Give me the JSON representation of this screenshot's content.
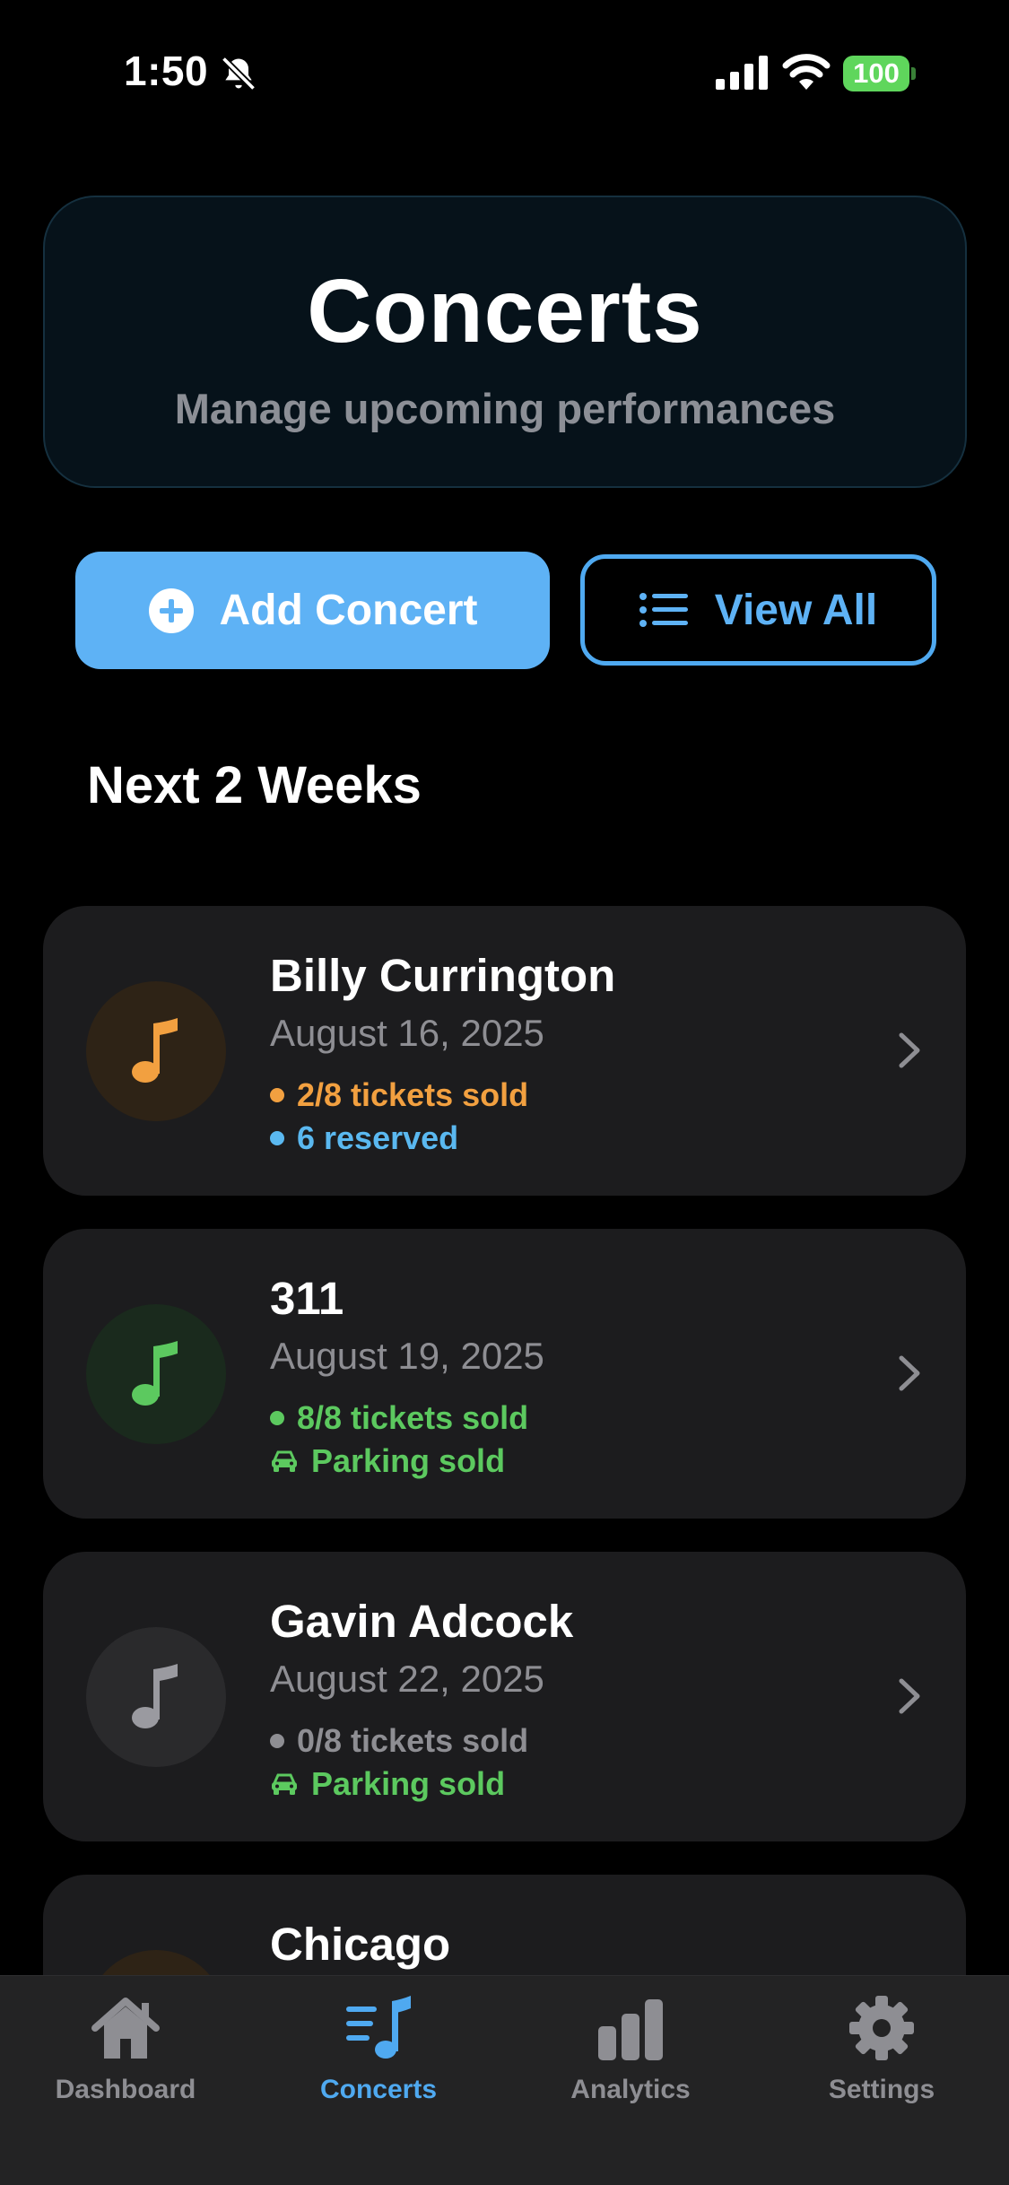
{
  "status_bar": {
    "time": "1:50",
    "battery": "100"
  },
  "header": {
    "title": "Concerts",
    "subtitle": "Manage upcoming performances"
  },
  "actions": {
    "add_label": "Add Concert",
    "view_all_label": "View All"
  },
  "section_title": "Next 2 Weeks",
  "concerts": [
    {
      "name": "Billy Currington",
      "date": "August 16, 2025",
      "tickets": "2/8 tickets sold",
      "extra": "6 reserved",
      "ticket_color": "#f2a040",
      "extra_color": "#5ab8f0",
      "extra_icon": "dot",
      "avatar_color": "#f2a040"
    },
    {
      "name": "311",
      "date": "August 19, 2025",
      "tickets": "8/8 tickets sold",
      "extra": "Parking sold",
      "ticket_color": "#5cc95f",
      "extra_color": "#5cc95f",
      "extra_icon": "car-icon",
      "avatar_color": "#5cc95f"
    },
    {
      "name": "Gavin Adcock",
      "date": "August 22, 2025",
      "tickets": "0/8 tickets sold",
      "extra": "Parking sold",
      "ticket_color": "#8e8e93",
      "extra_color": "#5cc95f",
      "extra_icon": "car-icon",
      "avatar_color": "#9a9aa0"
    },
    {
      "name": "Chicago"
    }
  ],
  "tabs": [
    {
      "label": "Dashboard",
      "icon": "house-icon",
      "active": false
    },
    {
      "label": "Concerts",
      "icon": "music-list-icon",
      "active": true
    },
    {
      "label": "Analytics",
      "icon": "bar-chart-icon",
      "active": false
    },
    {
      "label": "Settings",
      "icon": "gear-icon",
      "active": false
    }
  ],
  "colors": {
    "accent": "#5eb2f5",
    "card_bg": "#1c1c1e",
    "header_bg": "#06121a"
  }
}
